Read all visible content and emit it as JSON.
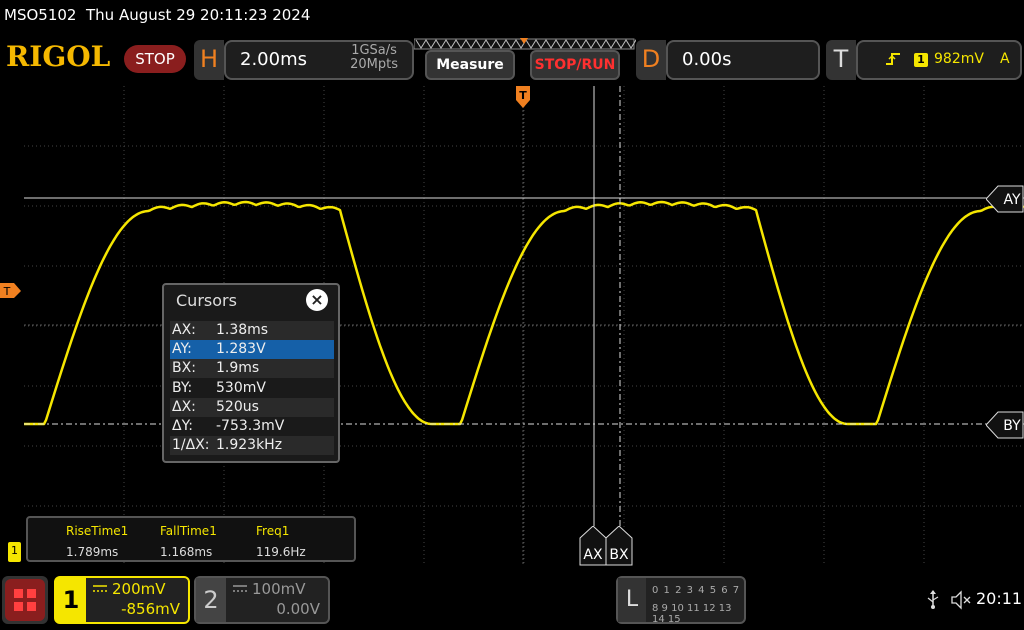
{
  "header": {
    "model": "MSO5102",
    "datetime": "Thu August 29 20:11:23 2024",
    "logo": "RIGOL",
    "run_state": "STOP"
  },
  "horizontal": {
    "letter": "H",
    "timebase": "2.00ms",
    "sample_rate": "1GSa/s",
    "memory_depth": "20Mpts"
  },
  "buttons": {
    "measure": "Measure",
    "stop_run": "STOP/RUN"
  },
  "delay": {
    "letter": "D",
    "value": "0.00s"
  },
  "trigger": {
    "letter": "T",
    "source": "1",
    "level": "982mV",
    "mode": "A",
    "marker": "T"
  },
  "cursors": {
    "title": "Cursors",
    "close_icon": "close-icon",
    "rows": [
      {
        "label": "AX:",
        "value": "1.38ms"
      },
      {
        "label": "AY:",
        "value": "1.283V"
      },
      {
        "label": "BX:",
        "value": "1.9ms"
      },
      {
        "label": "BY:",
        "value": "530mV"
      },
      {
        "label": "ΔX:",
        "value": "520us"
      },
      {
        "label": "ΔY:",
        "value": "-753.3mV"
      },
      {
        "label": "1/ΔX:",
        "value": "1.923kHz"
      }
    ],
    "selected_row": 1,
    "markers": {
      "ay": "AY",
      "by": "BY",
      "ax": "AX",
      "bx": "BX"
    }
  },
  "measurements": [
    {
      "label": "RiseTime1",
      "value": "1.789ms"
    },
    {
      "label": "FallTime1",
      "value": "1.168ms"
    },
    {
      "label": "Freq1",
      "value": "119.6Hz"
    }
  ],
  "meas_marker": "1",
  "channel1": {
    "number": "1",
    "scale": "200mV",
    "offset": "-856mV",
    "coupling_icon": "dc-coupling-icon"
  },
  "channel2": {
    "number": "2",
    "scale": "100mV",
    "offset": "0.00V",
    "coupling_icon": "dc-coupling-icon"
  },
  "logic": {
    "letter": "L",
    "row1": "0 1 2 3  4 5 6 7",
    "row2": "8 9 10 11 12 13 14 15"
  },
  "status": {
    "time": "20:11",
    "icons": [
      "usb-icon",
      "speaker-muted-icon"
    ]
  },
  "colors": {
    "ch1": "#f5e600",
    "accent": "#f08020",
    "stop_red": "#8a1e1e",
    "selection_blue": "#1560a8"
  }
}
